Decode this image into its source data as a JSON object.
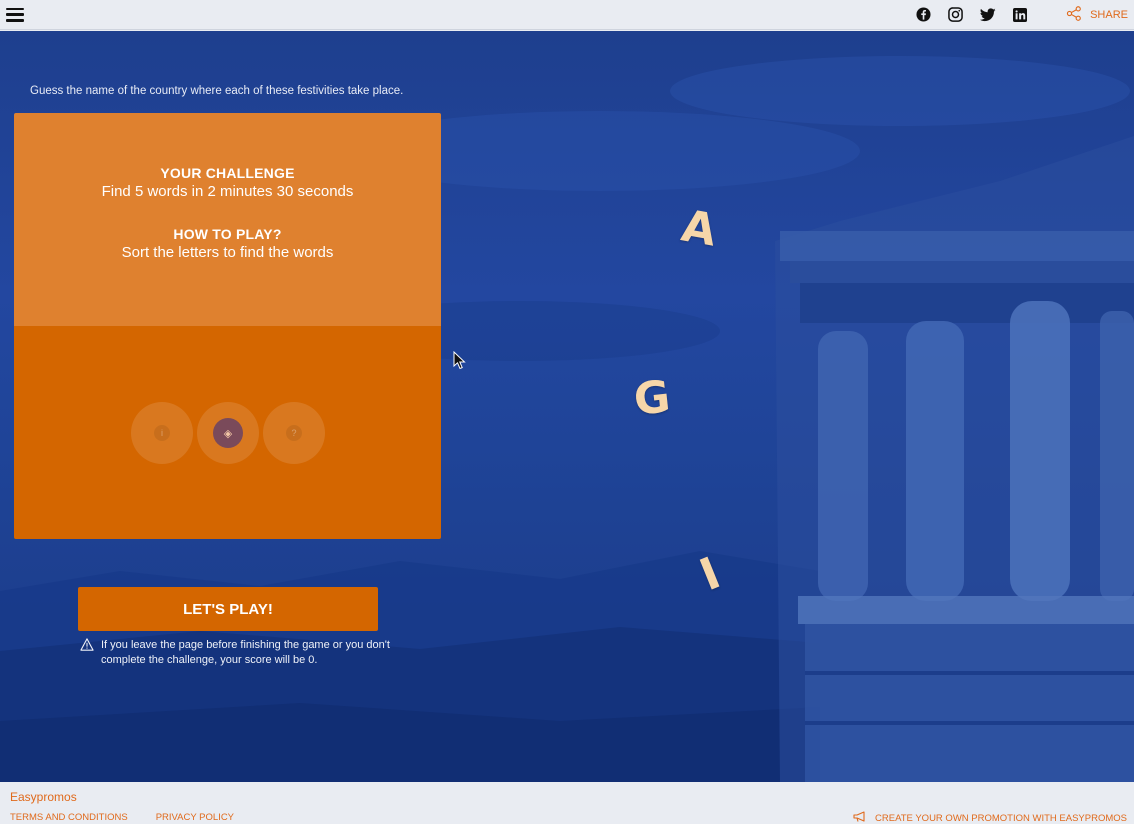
{
  "topbar": {
    "menu_icon": "hamburger-icon",
    "social_icons": [
      "facebook-icon",
      "instagram-icon",
      "twitter-icon",
      "linkedin-icon"
    ],
    "share_label": "SHARE",
    "share_icon": "share-icon"
  },
  "game": {
    "instruction": "Guess the name of the country where each of these festivities take place.",
    "challenge_heading": "YOUR CHALLENGE",
    "challenge_text": "Find 5 words in 2 minutes 30 seconds",
    "howto_heading": "HOW TO PLAY?",
    "howto_text": "Sort the letters to find the words",
    "play_button": "LET'S PLAY!",
    "warning_text": "If you leave the page before finishing the game or you don't complete the challenge, your score will be 0.",
    "floating_letters": [
      "A",
      "G",
      "I"
    ]
  },
  "footer": {
    "brand": "Easypromos",
    "terms": "TERMS AND CONDITIONS",
    "privacy": "PRIVACY POLICY",
    "create": "CREATE YOUR OWN PROMOTION WITH EASYPROMOS"
  },
  "colors": {
    "accent": "#d46600",
    "panel_light": "#df812f",
    "background_blue": "#1f4498",
    "letter": "#f6d6a9"
  }
}
